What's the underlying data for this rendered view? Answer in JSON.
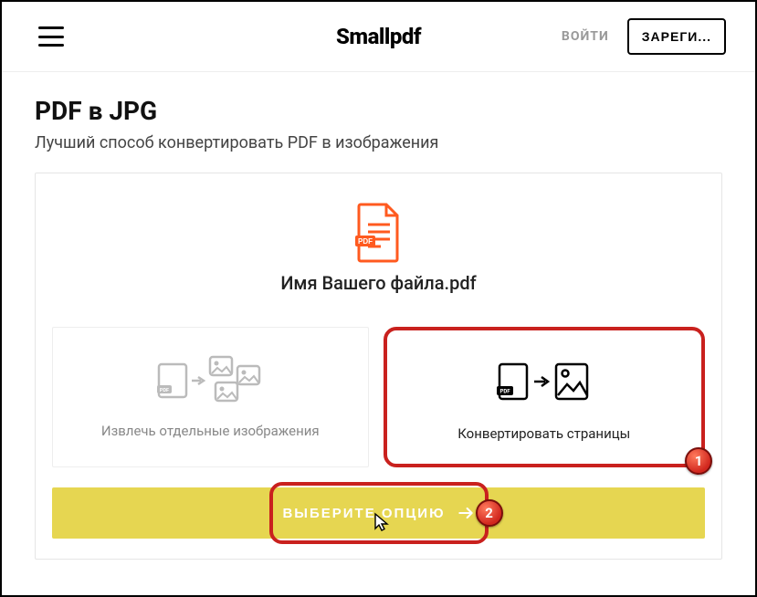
{
  "header": {
    "logo": "Smallpdf",
    "login": "ВОЙТИ",
    "signup": "ЗАРЕГИ..."
  },
  "page": {
    "title": "PDF в JPG",
    "subtitle": "Лучший способ конвертировать PDF в изображения"
  },
  "file": {
    "name": "Имя Вашего файла.pdf"
  },
  "options": {
    "extract": "Извлечь отдельные изображения",
    "convert": "Конвертировать страницы"
  },
  "cta": {
    "label": "ВЫБЕРИТЕ ОПЦИЮ"
  },
  "annotations": {
    "badge1": "1",
    "badge2": "2"
  }
}
